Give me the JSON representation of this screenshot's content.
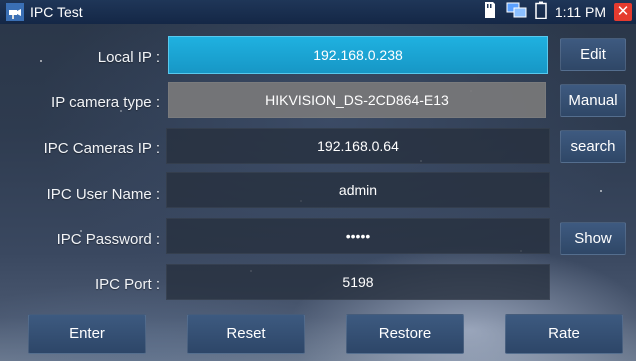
{
  "titlebar": {
    "title": "IPC Test",
    "time": "1:11 PM",
    "close_symbol": "✕",
    "icons": [
      "app-icon",
      "sd-card-icon",
      "network-icon",
      "battery-icon",
      "close-icon"
    ]
  },
  "form": {
    "rows": [
      {
        "label": "Local IP :",
        "value": "192.168.0.238",
        "button": "Edit"
      },
      {
        "label": "IP camera type :",
        "value": "HIKVISION_DS-2CD864-E13",
        "button": "Manual"
      },
      {
        "label": "IPC Cameras IP :",
        "value": "192.168.0.64",
        "button": "search"
      },
      {
        "label": "IPC User Name :",
        "value": "admin"
      },
      {
        "label": "IPC Password :",
        "value": "•••••",
        "button": "Show"
      },
      {
        "label": "IPC Port :",
        "value": "5198"
      }
    ]
  },
  "bottom": {
    "enter": "Enter",
    "reset": "Reset",
    "restore": "Restore",
    "rate": "Rate"
  },
  "colors": {
    "active_field": "#1fb1e0",
    "button": "#34506f",
    "close": "#e53b2f"
  }
}
